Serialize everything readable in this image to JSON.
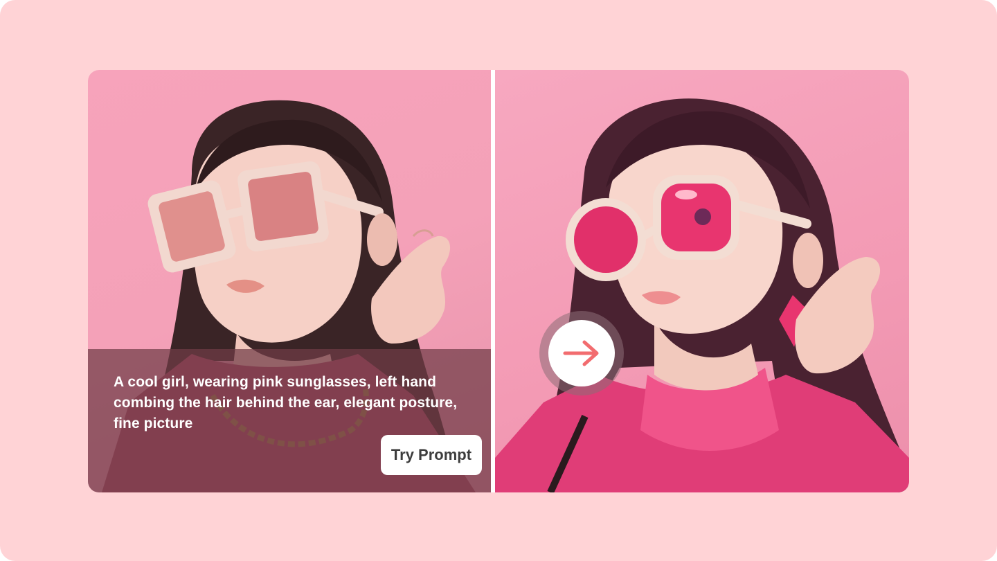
{
  "prompt": {
    "text": "A cool girl, wearing pink sunglasses, left hand combing the hair behind the ear, elegant posture, fine picture",
    "button_label": "Try Prompt"
  },
  "images": {
    "left": {
      "icon": "photo-portrait-girl-pink-sunglasses"
    },
    "right": {
      "icon": "anime-portrait-girl-pink-sunglasses"
    }
  },
  "arrow": {
    "icon": "arrow-right-icon"
  },
  "colors": {
    "page_bg": "#ffd3d6",
    "accent_arrow": "#f26c6f",
    "overlay": "#703c46",
    "button_bg": "#ffffff",
    "button_text": "#3d3d3d"
  }
}
